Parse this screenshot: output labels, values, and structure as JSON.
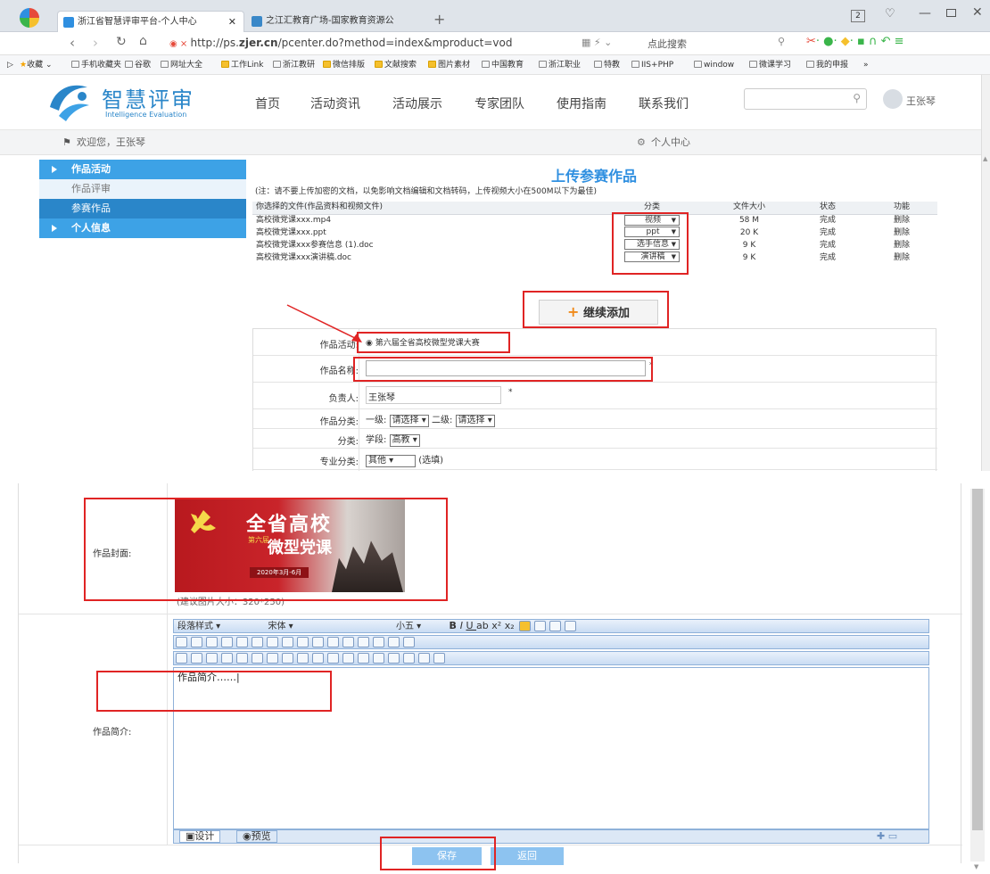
{
  "browser": {
    "tabs": [
      {
        "label": "浙江省智慧评审平台-个人中心",
        "active": true
      },
      {
        "label": "之江汇教育广场-国家教育资源公",
        "active": false
      }
    ],
    "new_tab": "+",
    "window_counter": "2",
    "url_prefix": "http://ps.",
    "url_domain": "zjer.cn",
    "url_rest": "/pcenter.do?method=index&mproduct=vod",
    "search_hint": "点此搜索",
    "favorites": [
      "收藏",
      "手机收藏夹",
      "谷歌",
      "网址大全",
      "工作Link",
      "浙江教研",
      "微信排版",
      "文献搜索",
      "图片素材",
      "中国教育",
      "浙江职业",
      "特教",
      "IIS+PHP",
      "window",
      "微课学习",
      "我的申报"
    ]
  },
  "site": {
    "logo_title": "智慧评审",
    "logo_subtitle": "Intelligence Evaluation",
    "nav": [
      "首页",
      "活动资讯",
      "活动展示",
      "专家团队",
      "使用指南",
      "联系我们"
    ],
    "user_name": "王张琴",
    "welcome": "欢迎您，王张琴",
    "personal_center": "个人中心"
  },
  "sidebar": {
    "items": [
      {
        "label": "作品活动",
        "kind": "header"
      },
      {
        "label": "作品评审",
        "kind": "sub"
      },
      {
        "label": "参赛作品",
        "kind": "selected"
      },
      {
        "label": "个人信息",
        "kind": "header"
      }
    ]
  },
  "upload": {
    "title": "上传参赛作品",
    "note": "(注：请不要上传加密的文档，以免影响文档编辑和文档转码，上传视频大小在500M以下为最佳)",
    "headers": [
      "你选择的文件(作品资料和视频文件)",
      "分类",
      "文件大小",
      "状态",
      "功能"
    ],
    "files": [
      {
        "name": "高校微党课xxx.mp4",
        "category": "视频",
        "size": "58 M",
        "status": "完成",
        "action": "删除"
      },
      {
        "name": "高校微党课xxx.ppt",
        "category": "ppt",
        "size": "20 K",
        "status": "完成",
        "action": "删除"
      },
      {
        "name": "高校微党课xxx参赛信息 (1).doc",
        "category": "选手信息",
        "size": "9 K",
        "status": "完成",
        "action": "删除"
      },
      {
        "name": "高校微党课xxx演讲稿.doc",
        "category": "演讲稿",
        "size": "9 K",
        "status": "完成",
        "action": "删除"
      }
    ],
    "continue_add": "继续添加"
  },
  "form": {
    "activity_label": "作品活动:",
    "activity_value": "第六届全省高校微型党课大赛",
    "name_label": "作品名称:",
    "name_value": "",
    "owner_label": "负责人:",
    "owner_value": "王张琴",
    "category_label": "作品分类:",
    "level1_label": "一级:",
    "level1_value": "请选择",
    "level2_label": "二级:",
    "level2_value": "请选择",
    "cls_label": "分类:",
    "stage_label": "学段:",
    "stage_value": "高教",
    "major_label": "专业分类:",
    "major_value": "其他",
    "major_hint": "(选填)",
    "required_mark": "*",
    "cover_label": "作品封面:",
    "cover_tip": "(建议图片大小：320*250)",
    "cover_title_line1": "全省高校",
    "cover_title_line2": "微型党课",
    "cover_small": "第六届",
    "cover_date": "2020年3月-6月",
    "intro_label": "作品简介:",
    "intro_text": "作品简介……|",
    "editor_para": "段落样式",
    "editor_font": "宋体",
    "editor_size": "小五",
    "design_tab": "设计",
    "preview_tab": "预览",
    "save": "保存",
    "back": "返回"
  },
  "colors": {
    "accent": "#3da2e6",
    "annotation": "#e02424",
    "title": "#2f8fe0",
    "plus": "#f08a1a"
  }
}
